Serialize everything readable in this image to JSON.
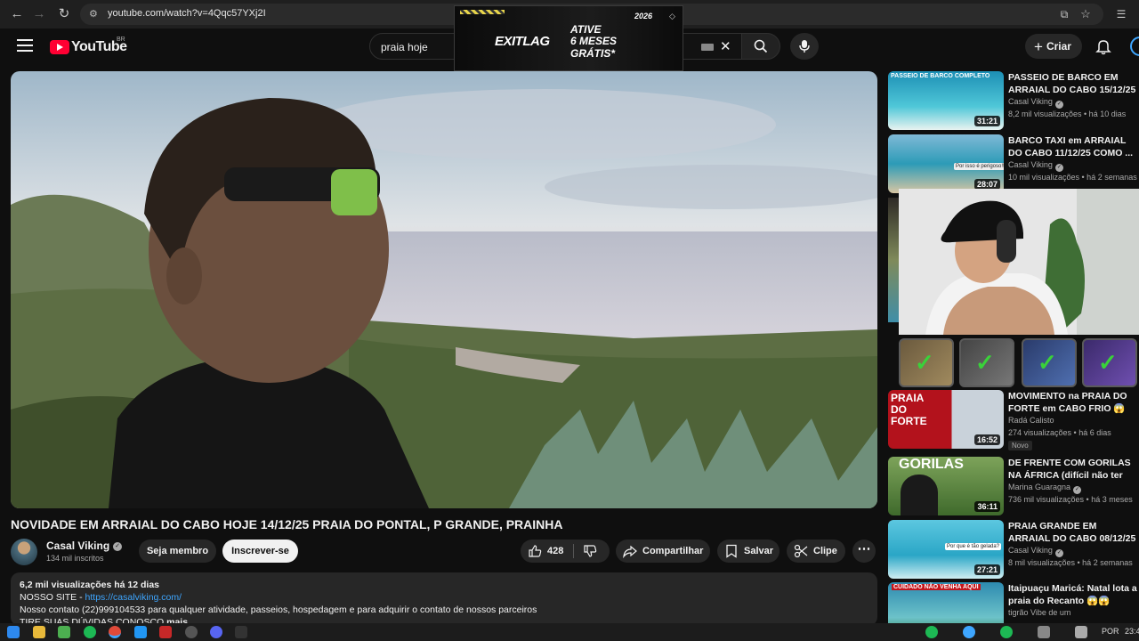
{
  "browser": {
    "url": "youtube.com/watch?v=4Qqc57YXj2I",
    "icons": [
      "back-icon",
      "forward-icon",
      "reload-icon",
      "site-info-icon",
      "install-icon",
      "bookmark-star-icon",
      "reading-list-icon"
    ]
  },
  "header": {
    "logo_text": "YouTube",
    "region": "BR",
    "search_value": "praia hoje",
    "create_label": "Criar"
  },
  "ad": {
    "brand": "EXITLAG",
    "line1": "ATIVE",
    "line2": "6 MESES",
    "line3": "GRÁTIS*",
    "year": "2026"
  },
  "video": {
    "title": "NOVIDADE EM ARRAIAL DO CABO HOJE 14/12/25 PRAIA DO PONTAL, P GRANDE, PRAINHA",
    "channel": "Casal Viking",
    "subscribers": "134 mil inscritos",
    "join_label": "Seja membro",
    "subscribe_label": "Inscrever-se",
    "likes": "428",
    "share_label": "Compartilhar",
    "save_label": "Salvar",
    "clip_label": "Clipe"
  },
  "description": {
    "stats": "6,2 mil visualizações  há 12 dias",
    "site_label": "NOSSO SITE - ",
    "site_link": "https://casalviking.com/",
    "contact": "Nosso contato (22)999104533 para qualquer atividade, passeios, hospedagem e para adquirir o contato de nossos parceiros",
    "line4": "TIRE SUAS DÚVIDAS CONOSCO",
    "more": "mais"
  },
  "recommendations": [
    {
      "title": "PASSEIO DE BARCO EM ARRAIAL DO CABO 15/12/25",
      "channel": "Casal Viking",
      "meta": "8,2 mil visualizações • há 10 dias",
      "duration": "31:21",
      "thumb_text": "PASSEIO DE BARCO COMPLETO"
    },
    {
      "title": "BARCO TAXI em ARRAIAL DO CABO 11/12/25 COMO ...",
      "channel": "Casal Viking",
      "meta": "10 mil visualizações • há 2 semanas",
      "duration": "28:07",
      "thumb_text": "Por isso é perigoso!!"
    },
    {
      "title": "MOVIMENTO na PRAIA DO FORTE em CABO FRIO 😱",
      "channel": "Radá Calisto",
      "meta": "274 visualizações • há 6 dias",
      "duration": "16:52",
      "badge": "Novo",
      "thumb_text": "PRAIA DO FORTE"
    },
    {
      "title": "DE FRENTE COM GORILAS NA ÁFRICA (difícil não ter medo)",
      "channel": "Marina Guaragna",
      "meta": "736 mil visualizações • há 3 meses",
      "duration": "36:11",
      "thumb_text": "GORILAS"
    },
    {
      "title": "PRAIA GRANDE EM ARRAIAL DO CABO 08/12/25",
      "channel": "Casal Viking",
      "meta": "8 mil visualizações • há 2 semanas",
      "duration": "27:21",
      "thumb_text": "Por que é tão gelada?"
    },
    {
      "title": "Itaipuaçu Maricá: Natal lota a praia do Recanto 😱😱",
      "channel": "tigrão Vibe de um",
      "meta": "",
      "duration": "",
      "thumb_text": "CUIDADO NÃO VENHA AQUI"
    }
  ],
  "taskbar": {
    "lang": "POR",
    "time": "23:4"
  },
  "colors": {
    "background": "#0f0f0f",
    "surface": "#272727",
    "accent_red": "#ff0033",
    "link_blue": "#3ea6ff",
    "achievement_green": "#3ad13a"
  }
}
